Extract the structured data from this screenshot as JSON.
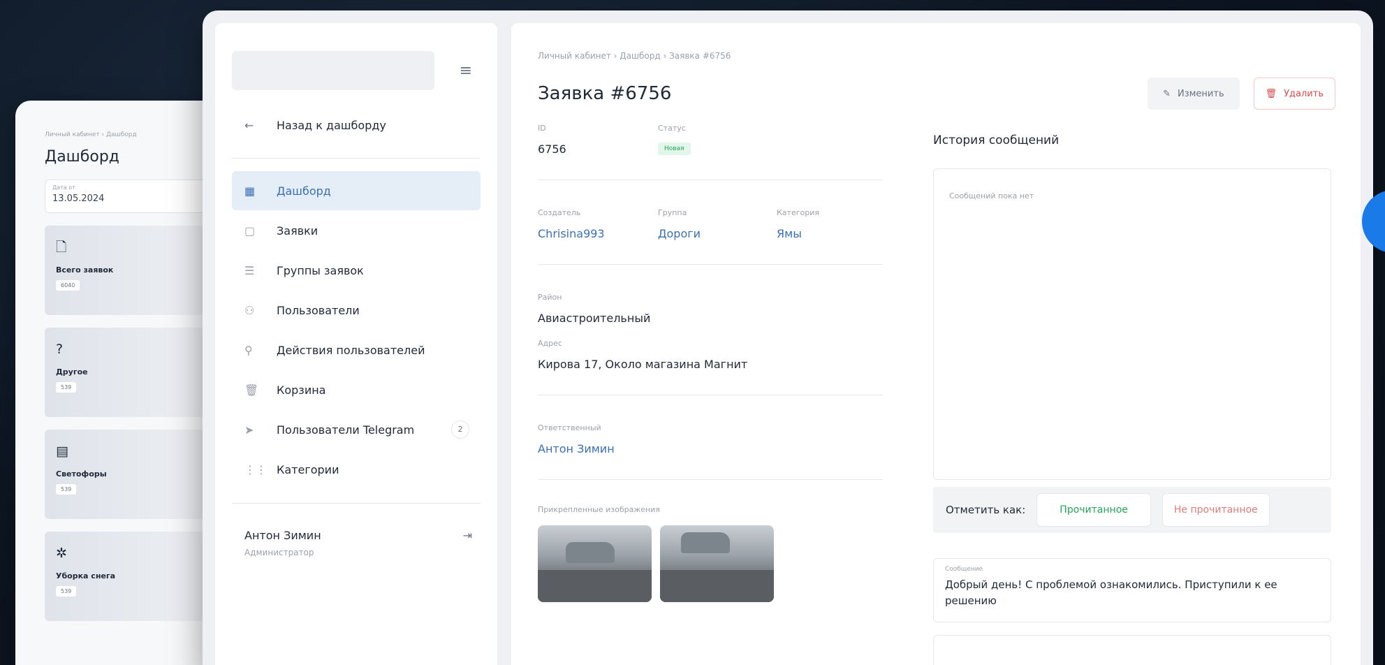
{
  "back_card": {
    "breadcrumb": "Личный кабинет  ›  Дашборд",
    "title": "Дашборд",
    "date_label": "Дата от",
    "date_value": "13.05.2024",
    "stats": [
      {
        "icon": "file-icon",
        "glyph": "🗋",
        "name": "Всего заявок",
        "count": "6040"
      },
      {
        "icon": "question-icon",
        "glyph": "?",
        "name": "Другое",
        "count": "539"
      },
      {
        "icon": "traffic-light-icon",
        "glyph": "▤",
        "name": "Светофоры",
        "count": "539"
      },
      {
        "icon": "snowflake-icon",
        "glyph": "✲",
        "name": "Уборка снега",
        "count": "539"
      }
    ]
  },
  "sidebar": {
    "back_label": "Назад к дашборду",
    "items": [
      {
        "label": "Дашборд",
        "glyph": "▦",
        "icon": "dashboard-icon",
        "active": true
      },
      {
        "label": "Заявки",
        "glyph": "▢",
        "icon": "requests-icon"
      },
      {
        "label": "Группы заявок",
        "glyph": "☰",
        "icon": "groups-icon"
      },
      {
        "label": "Пользователи",
        "glyph": "⚇",
        "icon": "users-icon"
      },
      {
        "label": "Действия пользователей",
        "glyph": "⚲",
        "icon": "user-actions-icon"
      },
      {
        "label": "Корзина",
        "glyph": "🗑",
        "icon": "trash-icon"
      },
      {
        "label": "Пользователи Telegram",
        "glyph": "➤",
        "icon": "telegram-icon",
        "badge": "2"
      },
      {
        "label": "Категории",
        "glyph": "⋮⋮",
        "icon": "categories-icon"
      }
    ],
    "user": {
      "name": "Антон Зимин",
      "role": "Администратор"
    }
  },
  "content": {
    "breadcrumb": "Личный кабинет  ›  Дашборд  ›  Заявка #6756",
    "title": "Заявка #6756",
    "edit_label": "Изменить",
    "delete_label": "Удалить",
    "fields": {
      "id_label": "ID",
      "id_value": "6756",
      "status_label": "Статус",
      "status_value": "Новая",
      "creator_label": "Создатель",
      "creator_value": "Chrisina993",
      "group_label": "Группа",
      "group_value": "Дороги",
      "category_label": "Категория",
      "category_value": "Ямы",
      "district_label": "Район",
      "district_value": "Авиастроительный",
      "address_label": "Адрес",
      "address_value": "Кирова 17, Около магазина Магнит",
      "responsible_label": "Ответственный",
      "responsible_value": "Антон Зимин",
      "images_label": "Прикрепленные изображения"
    },
    "history": {
      "title": "История сообщений",
      "empty": "Сообщений пока нет",
      "mark_label": "Отметить как:",
      "read_label": "Прочитанное",
      "unread_label": "Не прочитанное",
      "message_label": "Сообщение",
      "message_text": "Добрый день! С проблемой ознакомились. Приступили к ее решению"
    }
  },
  "colors": {
    "accent": "#3b6fb6",
    "success": "#23a55a",
    "danger": "#d94a4a",
    "bg": "#0d1623"
  }
}
